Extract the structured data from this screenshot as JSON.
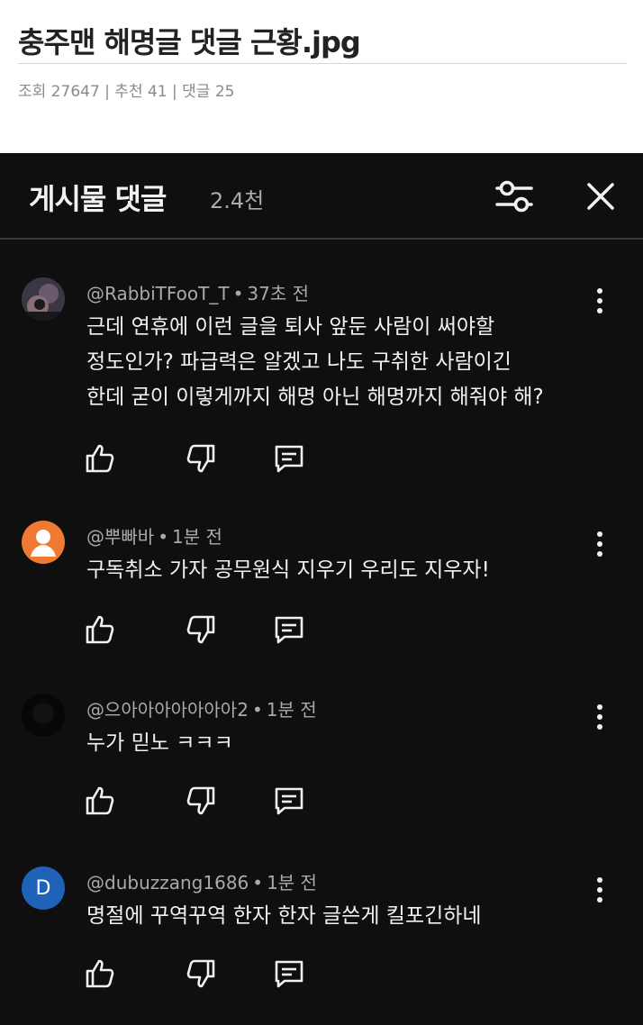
{
  "post": {
    "title": "충주맨 해명글 댓글 근황.jpg",
    "meta": "조회 27647 | 추천 41 | 댓글 25"
  },
  "panel": {
    "title": "게시물 댓글",
    "count": "2.4천",
    "filter_icon": "sliders-icon",
    "close_icon": "close-icon"
  },
  "comments": [
    {
      "author": "@RabbiTFooT_T",
      "time": "37초 전",
      "lines": [
        "근데 연휴에 이런 글을 퇴사 앞둔 사람이 써야할",
        "정도인가? 파급력은 알겠고 나도 구취한 사람이긴",
        "한데 굳이 이렇게까지 해명 아닌 해명까지 해줘야 해?"
      ],
      "avatar_type": "photo"
    },
    {
      "author": "@뿌빠바",
      "time": "1분 전",
      "lines": [
        "구독취소 가자 공무원식 지우기 우리도 지우자!"
      ],
      "avatar_type": "default-person",
      "avatar_color": "#f07a32"
    },
    {
      "author": "@으아아아아아아아2",
      "time": "1분 전",
      "lines": [
        "누가 믿노 ㅋㅋㅋ"
      ],
      "avatar_type": "dark"
    },
    {
      "author": "@dubuzzang1686",
      "time": "1분 전",
      "lines": [
        "명절에 꾸역꾸역 한자 한자 글쓴게 킬포긴하네"
      ],
      "avatar_type": "letter",
      "avatar_letter": "D",
      "avatar_color": "#1e63b8"
    }
  ],
  "actions": {
    "like_icon": "thumbs-up-icon",
    "dislike_icon": "thumbs-down-icon",
    "reply_icon": "reply-icon",
    "more_icon": "more-vertical-icon"
  }
}
